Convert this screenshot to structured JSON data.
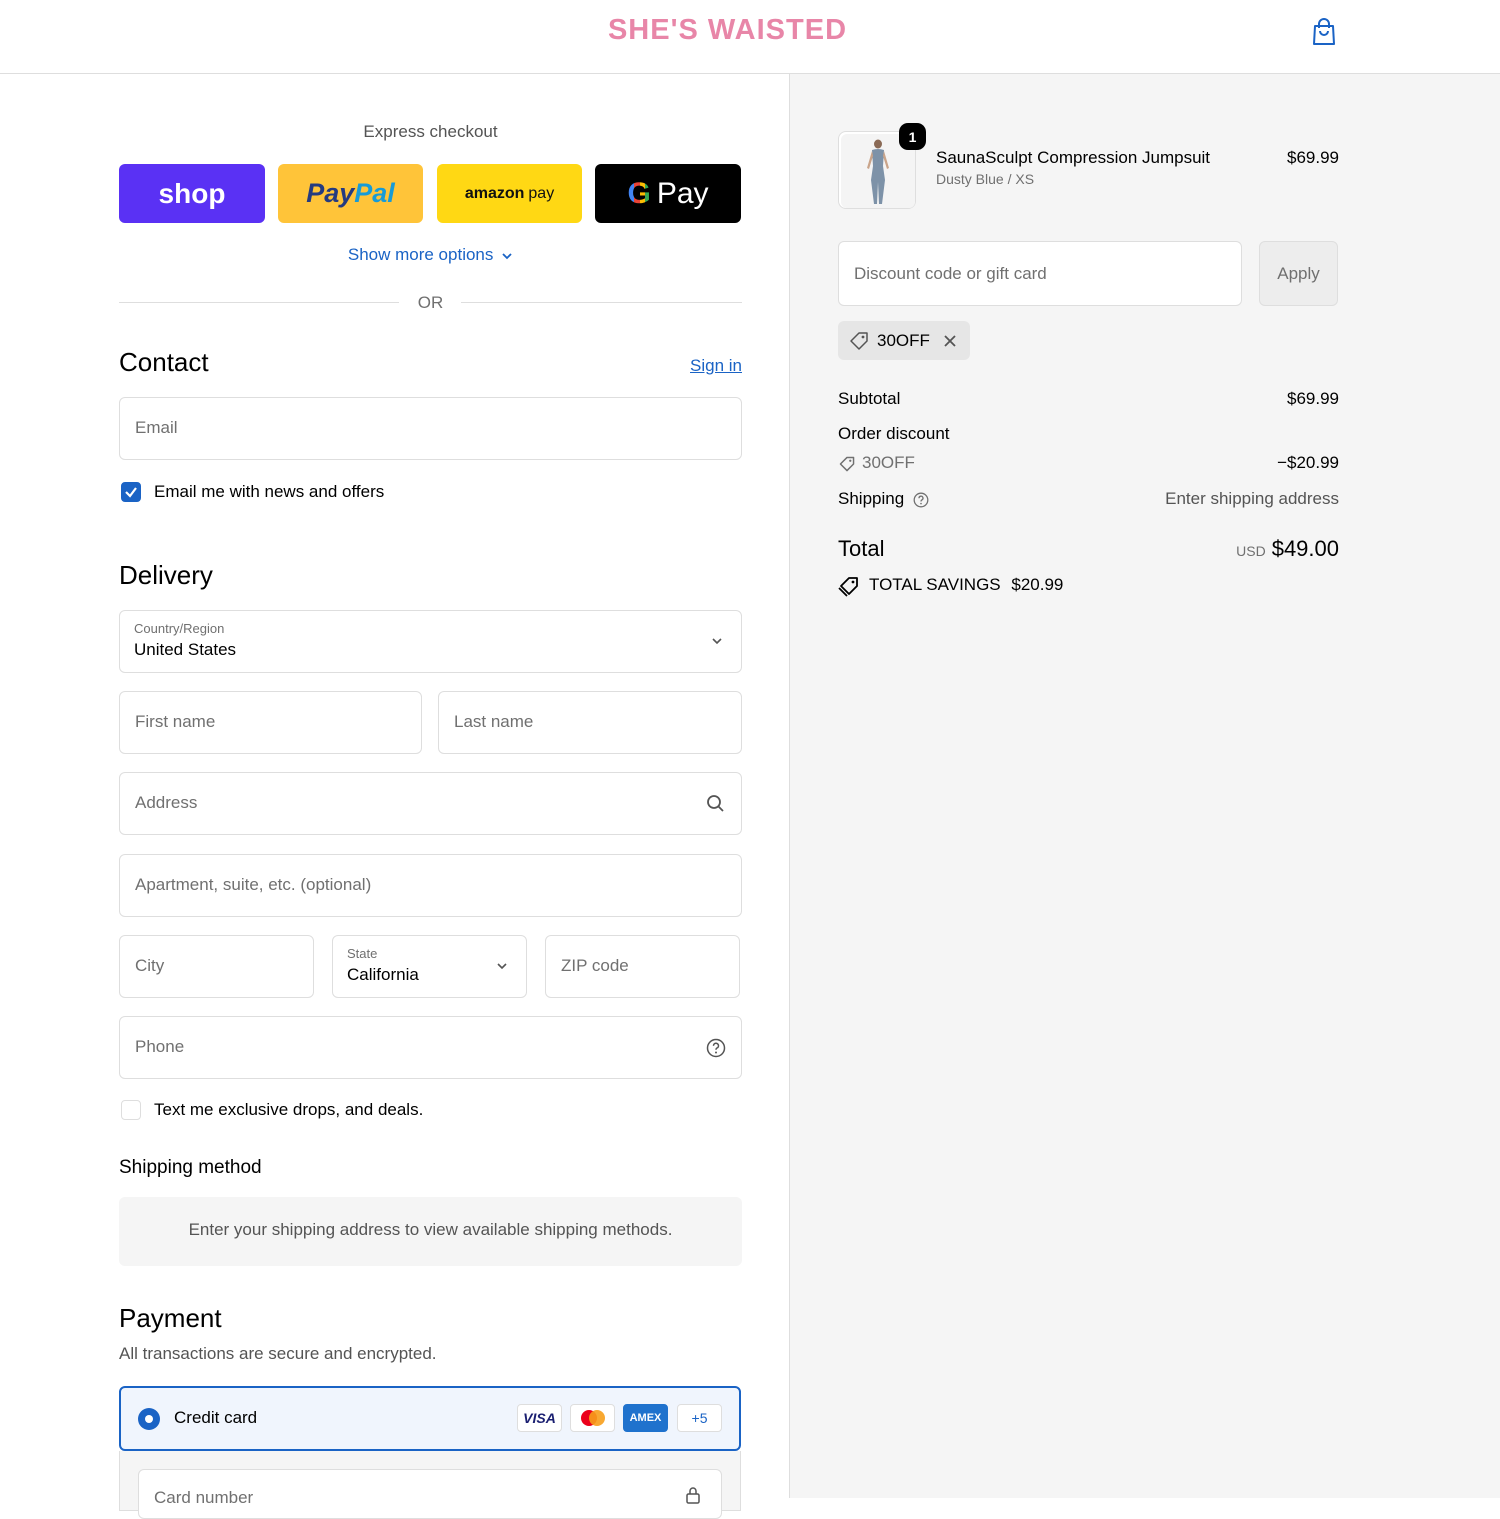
{
  "header": {
    "logo": "SHE'S WAISTED",
    "cart_icon": "shopping-bag-icon",
    "brand_color": "#e886a8"
  },
  "express": {
    "title": "Express checkout",
    "shop": "shop",
    "paypal_a": "Pay",
    "paypal_b": "Pal",
    "amazon_a": "amazon",
    "amazon_b": "pay",
    "gpay_g": "G",
    "gpay_text": "Pay",
    "show_more": "Show more options",
    "or": "OR"
  },
  "contact": {
    "title": "Contact",
    "sign_in": "Sign in",
    "email_placeholder": "Email",
    "news_label": "Email me with news and offers",
    "news_checked": true
  },
  "delivery": {
    "title": "Delivery",
    "country_label": "Country/Region",
    "country_value": "United States",
    "first_name": "First name",
    "last_name": "Last name",
    "address": "Address",
    "apartment": "Apartment, suite, etc. (optional)",
    "city": "City",
    "state_label": "State",
    "state_value": "California",
    "zip": "ZIP code",
    "phone": "Phone",
    "sms_label": "Text me exclusive drops, and deals.",
    "sms_checked": false
  },
  "shipping_method": {
    "title": "Shipping method",
    "message": "Enter your shipping address to view available shipping methods."
  },
  "payment": {
    "title": "Payment",
    "subtitle": "All transactions are secure and encrypted.",
    "credit_card_label": "Credit card",
    "cards": [
      "VISA",
      "MC",
      "AMEX",
      "+5"
    ],
    "card_number_placeholder": "Card number",
    "accent": "#1a63c5"
  },
  "summary": {
    "product_name": "SaunaSculpt Compression Jumpsuit",
    "product_variant": "Dusty Blue / XS",
    "product_price": "$69.99",
    "quantity": "1",
    "discount_placeholder": "Discount code or gift card",
    "apply": "Apply",
    "applied_code": "30OFF",
    "subtotal_label": "Subtotal",
    "subtotal_value": "$69.99",
    "order_discount_label": "Order discount",
    "discount_code": "30OFF",
    "discount_value": "−$20.99",
    "shipping_label": "Shipping",
    "shipping_value": "Enter shipping address",
    "total_label": "Total",
    "currency": "USD",
    "total_value": "$49.00",
    "savings_label": "TOTAL SAVINGS",
    "savings_value": "$20.99"
  }
}
